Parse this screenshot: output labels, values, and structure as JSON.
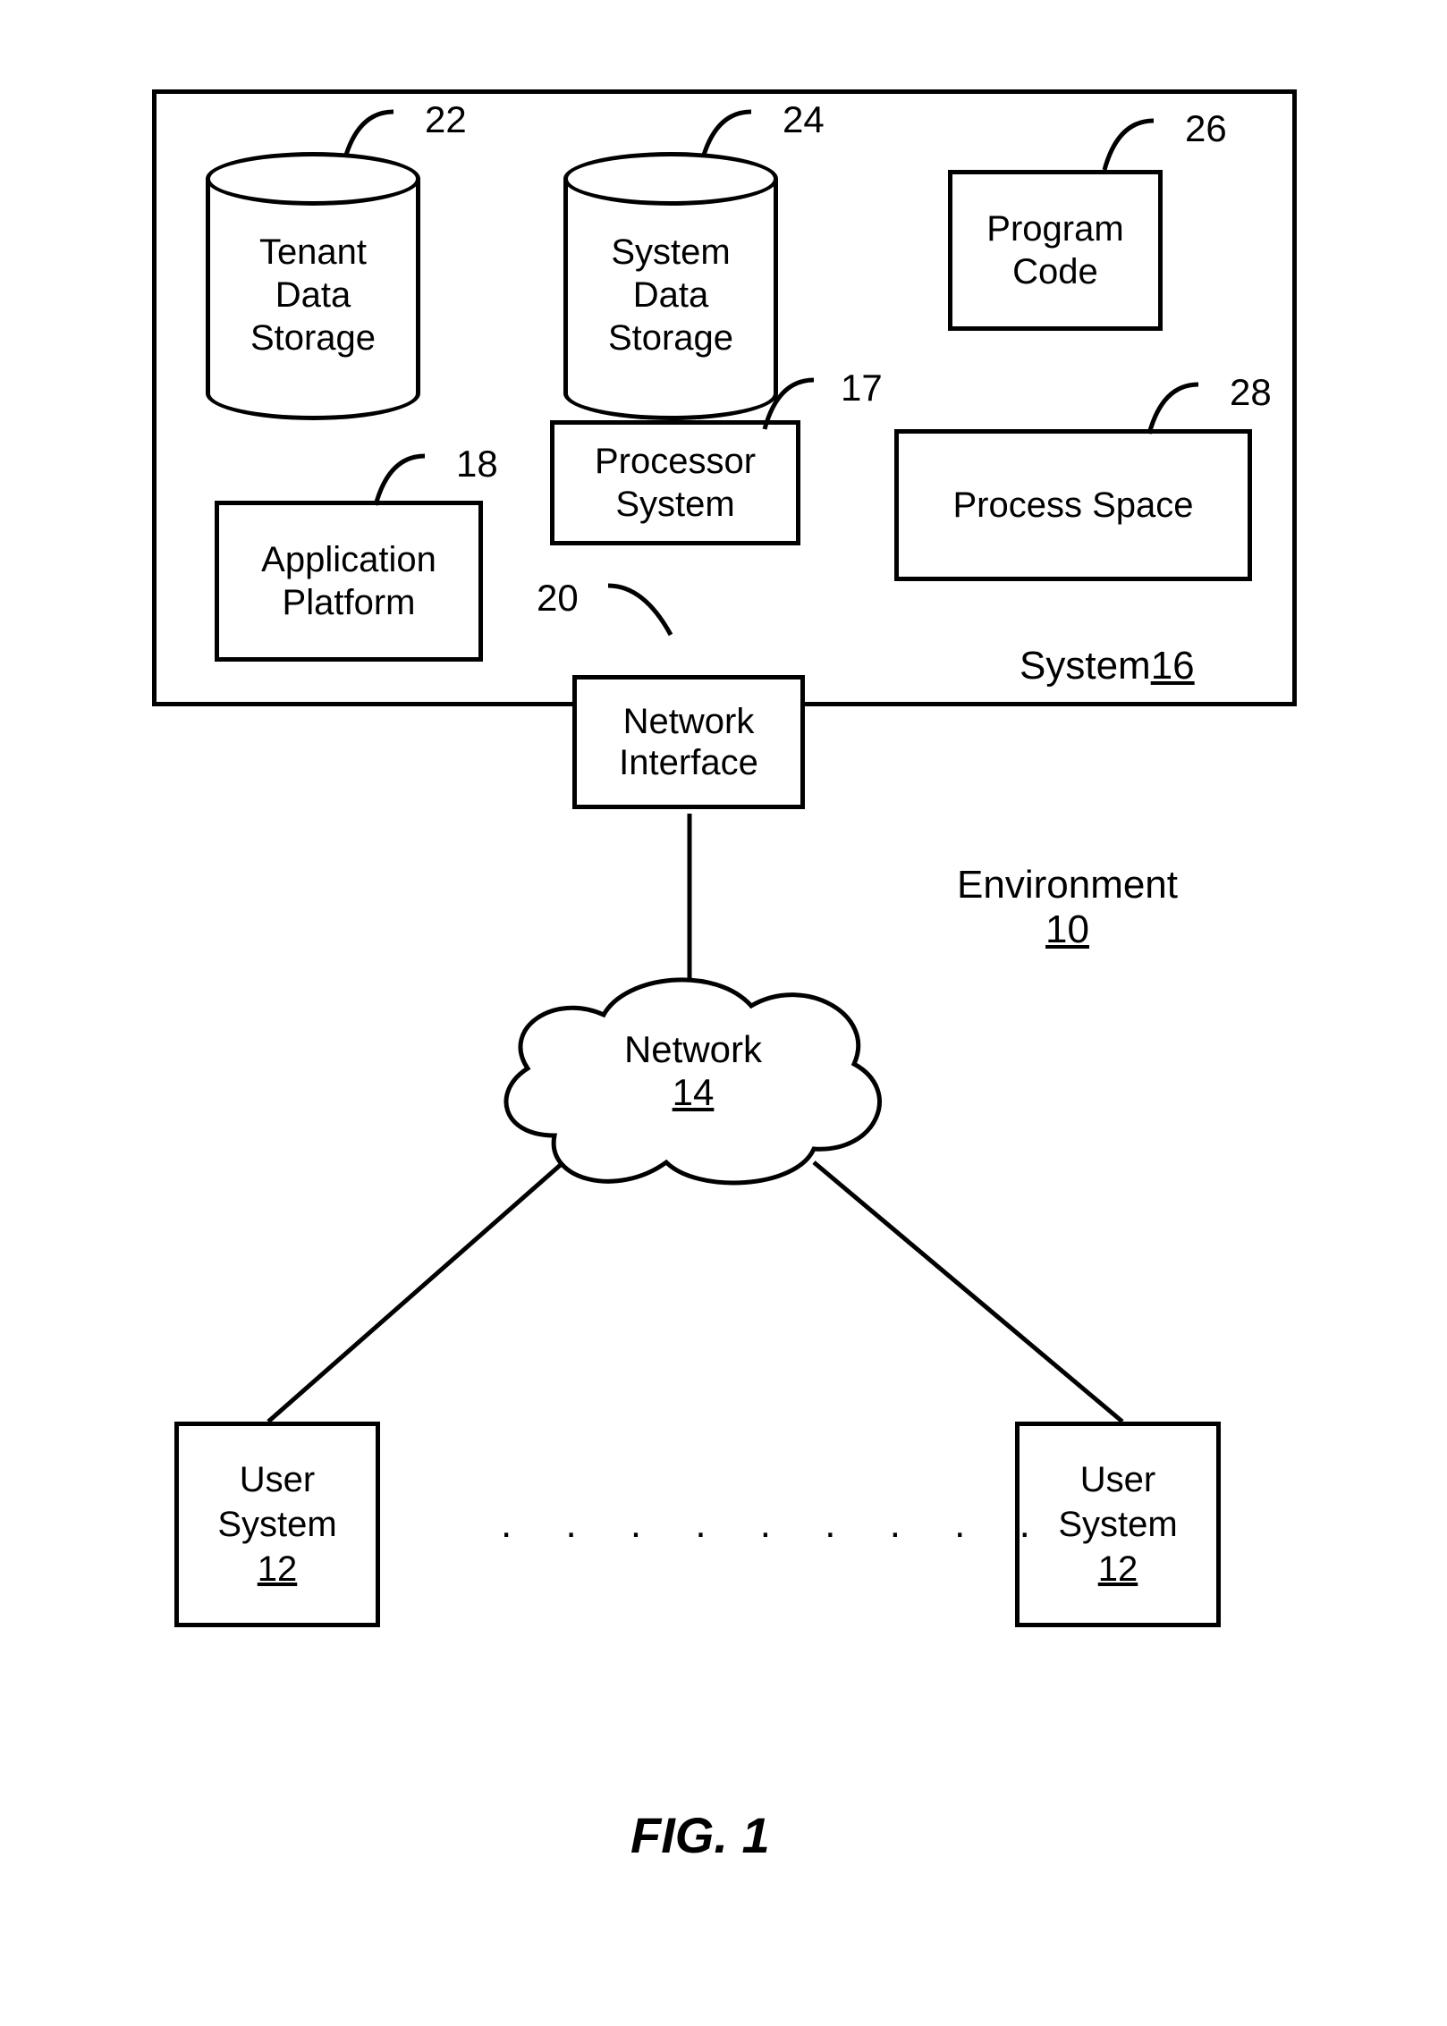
{
  "diagram": {
    "figure_label": "FIG. 1",
    "environment": {
      "label": "Environment",
      "num": "10"
    },
    "system": {
      "label": "System",
      "num": "16"
    },
    "tenant_storage": {
      "label": "Tenant\nData\nStorage",
      "num": "22"
    },
    "system_storage": {
      "label": "System\nData\nStorage",
      "num": "24"
    },
    "program_code": {
      "label": "Program\nCode",
      "num": "26"
    },
    "processor_system": {
      "label": "Processor\nSystem",
      "num": "17"
    },
    "process_space": {
      "label": "Process Space",
      "num": "28"
    },
    "application_platform": {
      "label": "Application\nPlatform",
      "num": "18"
    },
    "network_interface": {
      "label": "Network\nInterface",
      "num": "20"
    },
    "network": {
      "label": "Network",
      "num": "14"
    },
    "user_system_left": {
      "label": "User\nSystem",
      "num": "12"
    },
    "user_system_right": {
      "label": "User\nSystem",
      "num": "12"
    },
    "ellipsis": ". . . . . . . . ."
  }
}
